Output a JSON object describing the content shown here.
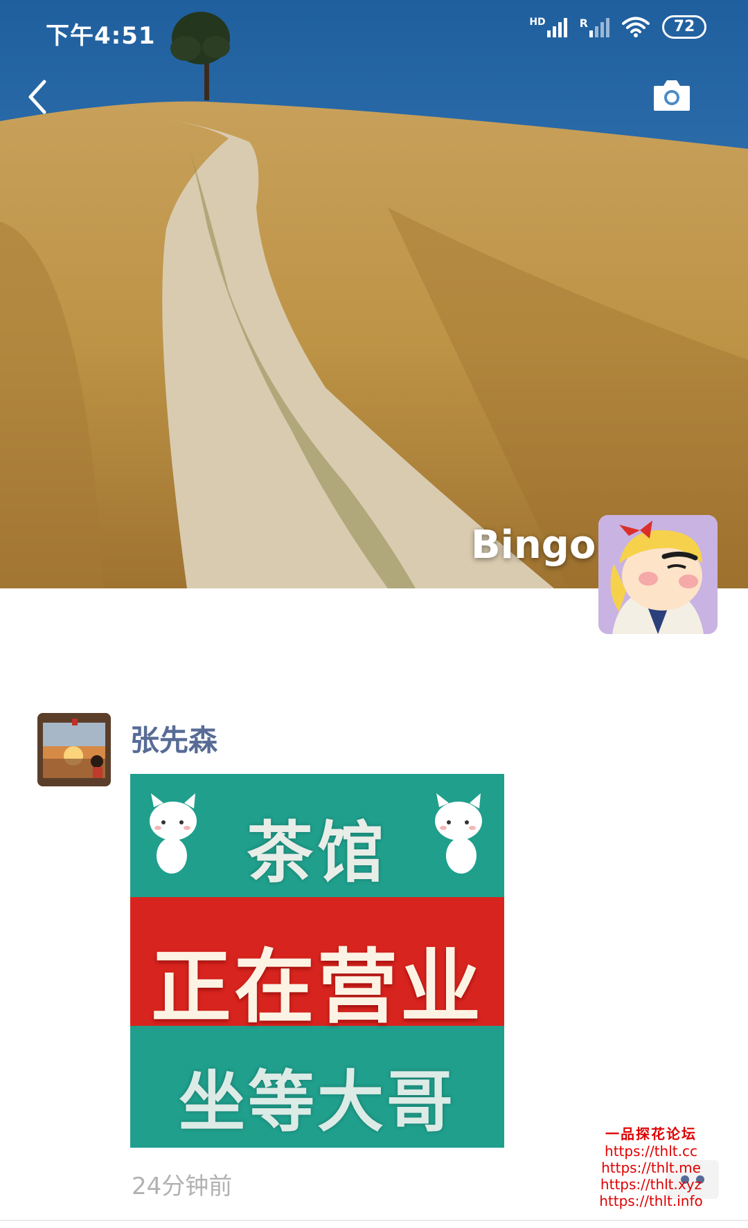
{
  "status_bar": {
    "time": "下午4:51",
    "network_hd": "HD",
    "network_r": "R",
    "battery": "72"
  },
  "nav": {
    "back_icon": "chevron-left-icon",
    "camera_icon": "camera-icon"
  },
  "profile": {
    "name": "Bingo"
  },
  "post": {
    "author": "张先森",
    "image_lines": [
      "茶馆",
      "正在营业",
      "坐等大哥"
    ],
    "time": "24分钟前"
  },
  "watermark": {
    "title": "一品探花论坛",
    "links": [
      "https://thlt.cc",
      "https://thlt.me",
      "https://thlt.xyz",
      "https://thlt.info"
    ]
  },
  "colors": {
    "link_blue": "#576b95",
    "time_gray": "#b2b2b2",
    "watermark_red": "#e00000"
  }
}
